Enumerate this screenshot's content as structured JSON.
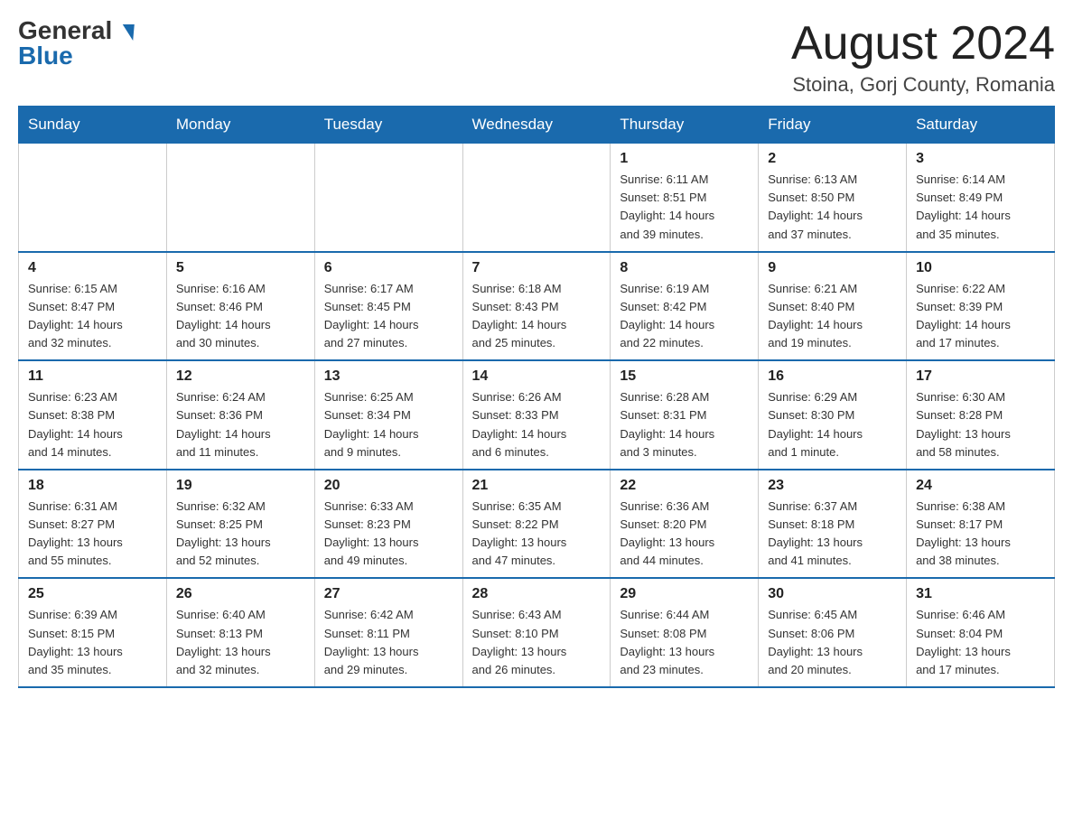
{
  "logo": {
    "general": "General",
    "blue": "Blue"
  },
  "title": "August 2024",
  "location": "Stoina, Gorj County, Romania",
  "days_of_week": [
    "Sunday",
    "Monday",
    "Tuesday",
    "Wednesday",
    "Thursday",
    "Friday",
    "Saturday"
  ],
  "weeks": [
    [
      {
        "day": "",
        "info": ""
      },
      {
        "day": "",
        "info": ""
      },
      {
        "day": "",
        "info": ""
      },
      {
        "day": "",
        "info": ""
      },
      {
        "day": "1",
        "info": "Sunrise: 6:11 AM\nSunset: 8:51 PM\nDaylight: 14 hours\nand 39 minutes."
      },
      {
        "day": "2",
        "info": "Sunrise: 6:13 AM\nSunset: 8:50 PM\nDaylight: 14 hours\nand 37 minutes."
      },
      {
        "day": "3",
        "info": "Sunrise: 6:14 AM\nSunset: 8:49 PM\nDaylight: 14 hours\nand 35 minutes."
      }
    ],
    [
      {
        "day": "4",
        "info": "Sunrise: 6:15 AM\nSunset: 8:47 PM\nDaylight: 14 hours\nand 32 minutes."
      },
      {
        "day": "5",
        "info": "Sunrise: 6:16 AM\nSunset: 8:46 PM\nDaylight: 14 hours\nand 30 minutes."
      },
      {
        "day": "6",
        "info": "Sunrise: 6:17 AM\nSunset: 8:45 PM\nDaylight: 14 hours\nand 27 minutes."
      },
      {
        "day": "7",
        "info": "Sunrise: 6:18 AM\nSunset: 8:43 PM\nDaylight: 14 hours\nand 25 minutes."
      },
      {
        "day": "8",
        "info": "Sunrise: 6:19 AM\nSunset: 8:42 PM\nDaylight: 14 hours\nand 22 minutes."
      },
      {
        "day": "9",
        "info": "Sunrise: 6:21 AM\nSunset: 8:40 PM\nDaylight: 14 hours\nand 19 minutes."
      },
      {
        "day": "10",
        "info": "Sunrise: 6:22 AM\nSunset: 8:39 PM\nDaylight: 14 hours\nand 17 minutes."
      }
    ],
    [
      {
        "day": "11",
        "info": "Sunrise: 6:23 AM\nSunset: 8:38 PM\nDaylight: 14 hours\nand 14 minutes."
      },
      {
        "day": "12",
        "info": "Sunrise: 6:24 AM\nSunset: 8:36 PM\nDaylight: 14 hours\nand 11 minutes."
      },
      {
        "day": "13",
        "info": "Sunrise: 6:25 AM\nSunset: 8:34 PM\nDaylight: 14 hours\nand 9 minutes."
      },
      {
        "day": "14",
        "info": "Sunrise: 6:26 AM\nSunset: 8:33 PM\nDaylight: 14 hours\nand 6 minutes."
      },
      {
        "day": "15",
        "info": "Sunrise: 6:28 AM\nSunset: 8:31 PM\nDaylight: 14 hours\nand 3 minutes."
      },
      {
        "day": "16",
        "info": "Sunrise: 6:29 AM\nSunset: 8:30 PM\nDaylight: 14 hours\nand 1 minute."
      },
      {
        "day": "17",
        "info": "Sunrise: 6:30 AM\nSunset: 8:28 PM\nDaylight: 13 hours\nand 58 minutes."
      }
    ],
    [
      {
        "day": "18",
        "info": "Sunrise: 6:31 AM\nSunset: 8:27 PM\nDaylight: 13 hours\nand 55 minutes."
      },
      {
        "day": "19",
        "info": "Sunrise: 6:32 AM\nSunset: 8:25 PM\nDaylight: 13 hours\nand 52 minutes."
      },
      {
        "day": "20",
        "info": "Sunrise: 6:33 AM\nSunset: 8:23 PM\nDaylight: 13 hours\nand 49 minutes."
      },
      {
        "day": "21",
        "info": "Sunrise: 6:35 AM\nSunset: 8:22 PM\nDaylight: 13 hours\nand 47 minutes."
      },
      {
        "day": "22",
        "info": "Sunrise: 6:36 AM\nSunset: 8:20 PM\nDaylight: 13 hours\nand 44 minutes."
      },
      {
        "day": "23",
        "info": "Sunrise: 6:37 AM\nSunset: 8:18 PM\nDaylight: 13 hours\nand 41 minutes."
      },
      {
        "day": "24",
        "info": "Sunrise: 6:38 AM\nSunset: 8:17 PM\nDaylight: 13 hours\nand 38 minutes."
      }
    ],
    [
      {
        "day": "25",
        "info": "Sunrise: 6:39 AM\nSunset: 8:15 PM\nDaylight: 13 hours\nand 35 minutes."
      },
      {
        "day": "26",
        "info": "Sunrise: 6:40 AM\nSunset: 8:13 PM\nDaylight: 13 hours\nand 32 minutes."
      },
      {
        "day": "27",
        "info": "Sunrise: 6:42 AM\nSunset: 8:11 PM\nDaylight: 13 hours\nand 29 minutes."
      },
      {
        "day": "28",
        "info": "Sunrise: 6:43 AM\nSunset: 8:10 PM\nDaylight: 13 hours\nand 26 minutes."
      },
      {
        "day": "29",
        "info": "Sunrise: 6:44 AM\nSunset: 8:08 PM\nDaylight: 13 hours\nand 23 minutes."
      },
      {
        "day": "30",
        "info": "Sunrise: 6:45 AM\nSunset: 8:06 PM\nDaylight: 13 hours\nand 20 minutes."
      },
      {
        "day": "31",
        "info": "Sunrise: 6:46 AM\nSunset: 8:04 PM\nDaylight: 13 hours\nand 17 minutes."
      }
    ]
  ]
}
